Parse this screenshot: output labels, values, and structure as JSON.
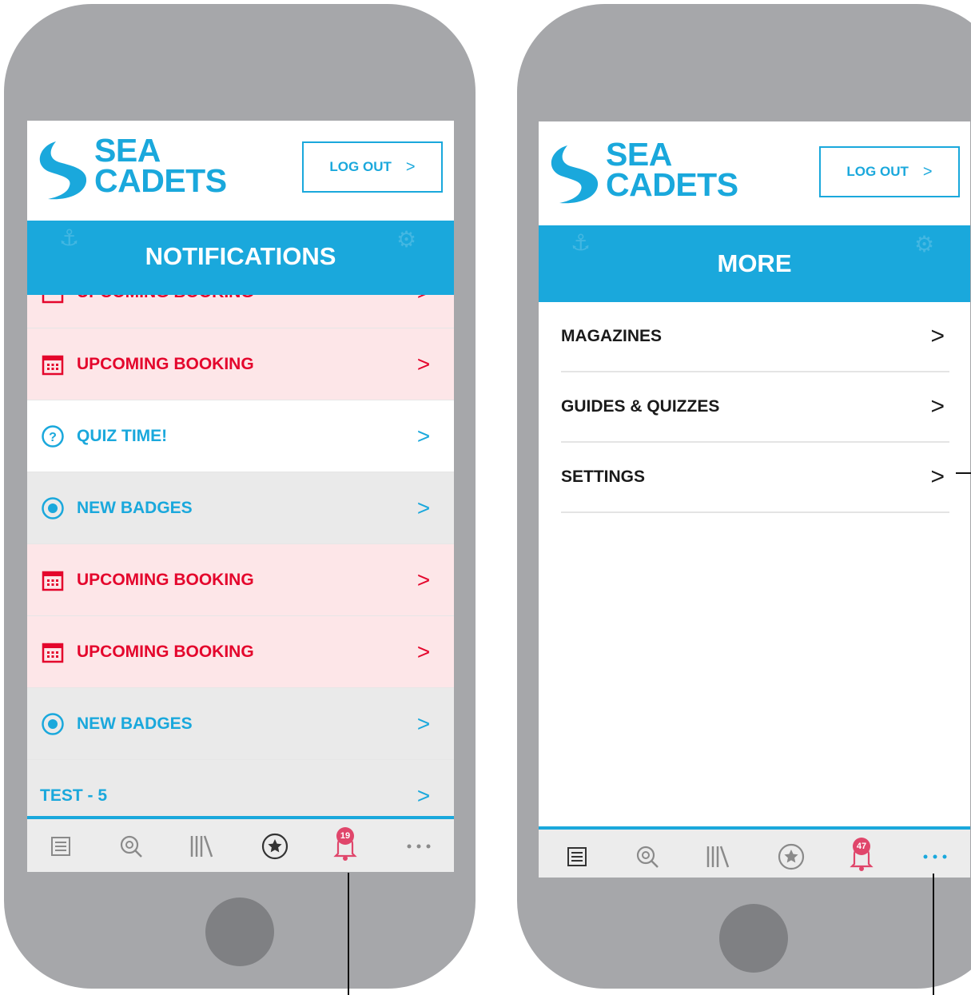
{
  "brand": {
    "line1": "SEA",
    "line2": "CADETS",
    "color": "#1aa8dc"
  },
  "left_screen": {
    "logout_label": "LOG OUT",
    "title": "NOTIFICATIONS",
    "partial_row_label": "UPCOMING BOOKING",
    "rows": [
      {
        "type": "booking",
        "label": "UPCOMING BOOKING",
        "icon": "calendar-icon"
      },
      {
        "type": "quiz",
        "label": "QUIZ TIME!",
        "icon": "question-icon"
      },
      {
        "type": "badges",
        "label": "NEW BADGES",
        "icon": "badge-icon"
      },
      {
        "type": "booking",
        "label": "UPCOMING BOOKING",
        "icon": "calendar-icon"
      },
      {
        "type": "booking",
        "label": "UPCOMING BOOKING",
        "icon": "calendar-icon"
      },
      {
        "type": "badges",
        "label": "NEW BADGES",
        "icon": "badge-icon"
      },
      {
        "type": "test",
        "label": "TEST - 5",
        "icon": ""
      }
    ],
    "notification_count": "19"
  },
  "right_screen": {
    "logout_label": "LOG OUT",
    "title": "MORE",
    "menu": [
      {
        "label": "MAGAZINES"
      },
      {
        "label": "GUIDES & QUIZZES"
      },
      {
        "label": "SETTINGS"
      }
    ],
    "notification_count": "47"
  },
  "tabs": [
    "list-icon",
    "search-icon",
    "library-icon",
    "star-icon",
    "bell-icon",
    "more-dots-icon"
  ],
  "colors": {
    "accent": "#1aa8dc",
    "booking": "#e4062c",
    "booking_bg": "#fde6e8",
    "badge": "#e0466b"
  }
}
